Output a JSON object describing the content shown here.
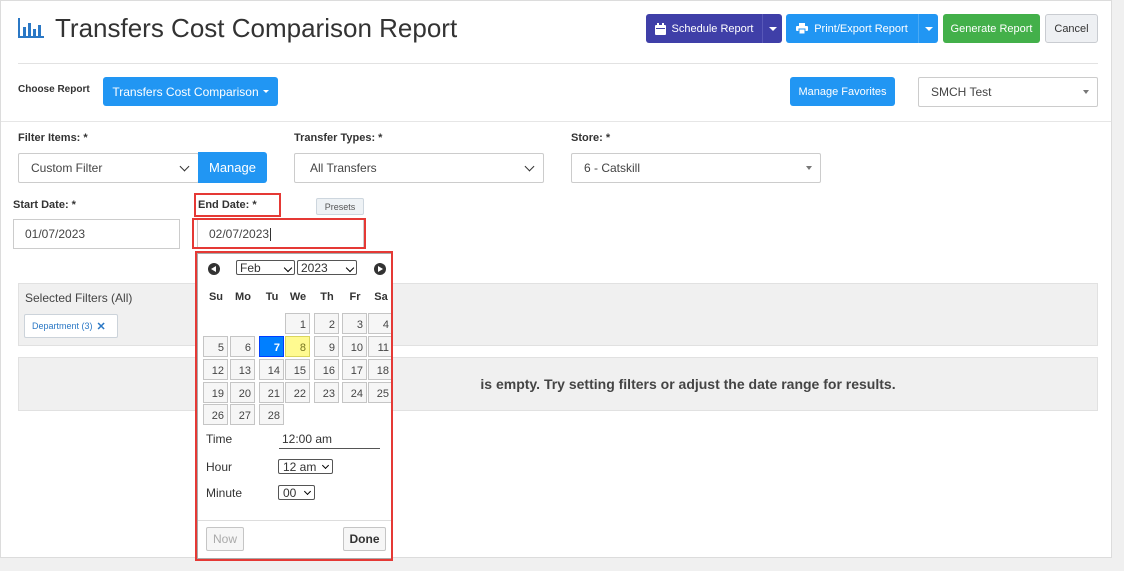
{
  "header": {
    "title": "Transfers Cost Comparison Report",
    "schedule_label": "Schedule Report",
    "print_label": "Print/Export Report",
    "generate_label": "Generate Report",
    "cancel_label": "Cancel"
  },
  "choose": {
    "label": "Choose Report",
    "value": "Transfers Cost Comparison",
    "favorites_label": "Manage Favorites",
    "favorite_value": "SMCH Test"
  },
  "filters": {
    "filter_items_label": "Filter Items: *",
    "filter_items_value": "Custom Filter",
    "manage_label": "Manage",
    "transfer_types_label": "Transfer Types: *",
    "transfer_types_value": "All Transfers",
    "store_label": "Store: *",
    "store_value": "6 - Catskill"
  },
  "dates": {
    "start_label": "Start Date: *",
    "start_value": "01/07/2023",
    "end_label": "End Date: *",
    "end_value": "02/07/2023",
    "presets_label": "Presets"
  },
  "selected_filters": {
    "title": "Selected Filters (All)",
    "chip_label": "Department (3)",
    "chip_close": "✕"
  },
  "empty_message": "is empty. Try setting filters or adjust the date range for results.",
  "datepicker": {
    "month": "Feb",
    "year": "2023",
    "weekdays": [
      "Su",
      "Mo",
      "Tu",
      "We",
      "Th",
      "Fr",
      "Sa"
    ],
    "weeks": [
      [
        "",
        "",
        "",
        "1",
        "2",
        "3",
        "4"
      ],
      [
        "5",
        "6",
        "7",
        "8",
        "9",
        "10",
        "11"
      ],
      [
        "12",
        "13",
        "14",
        "15",
        "16",
        "17",
        "18"
      ],
      [
        "19",
        "20",
        "21",
        "22",
        "23",
        "24",
        "25"
      ],
      [
        "26",
        "27",
        "28",
        "",
        "",
        "",
        ""
      ]
    ],
    "selected_day": "7",
    "today_day": "8",
    "time_label": "Time",
    "time_value": "12:00 am",
    "hour_label": "Hour",
    "hour_value": "12 am",
    "minute_label": "Minute",
    "minute_value": "00",
    "now_label": "Now",
    "done_label": "Done"
  },
  "colors": {
    "primary": "#2196f3",
    "schedule": "#3f3fa8",
    "generate": "#43b04a",
    "highlight": "#e53935"
  }
}
